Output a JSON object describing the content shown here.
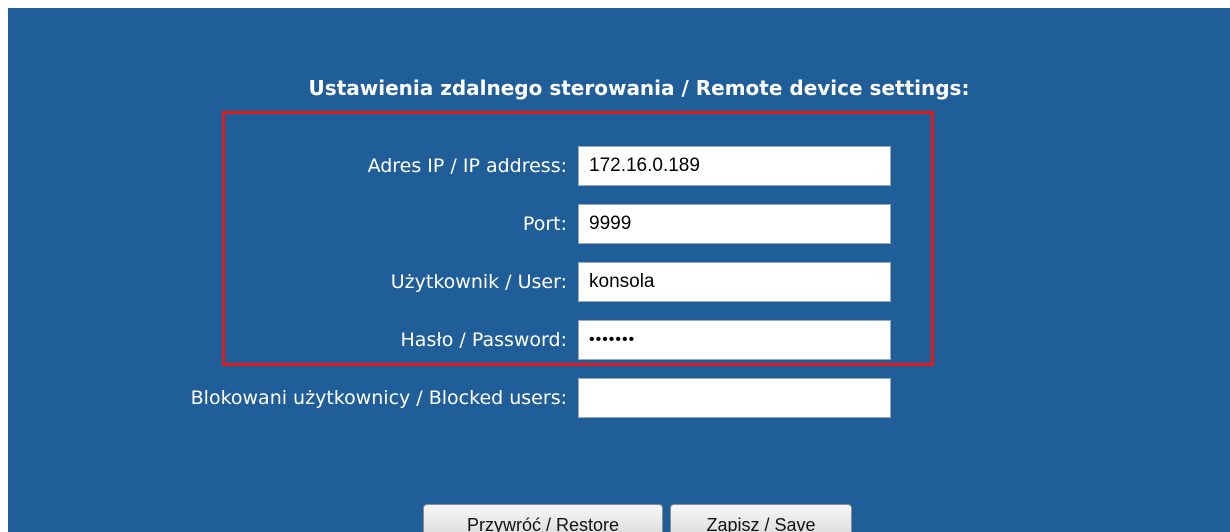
{
  "page": {
    "title": "Ustawienia zdalnego sterowania / Remote device settings:"
  },
  "fields": {
    "ip": {
      "label": "Adres IP / IP address:",
      "value": "172.16.0.189"
    },
    "port": {
      "label": "Port:",
      "value": "9999"
    },
    "user": {
      "label": "Użytkownik / User:",
      "value": "konsola"
    },
    "password": {
      "label": "Hasło / Password:",
      "value": "•••••••"
    },
    "blocked": {
      "label": "Blokowani użytkownicy / Blocked users:",
      "value": ""
    }
  },
  "buttons": {
    "restore": "Przywróć / Restore",
    "save": "Zapisz / Save"
  },
  "colors": {
    "panel": "#1f5e99",
    "highlight": "#e11a1a",
    "text": "#ffffff"
  }
}
